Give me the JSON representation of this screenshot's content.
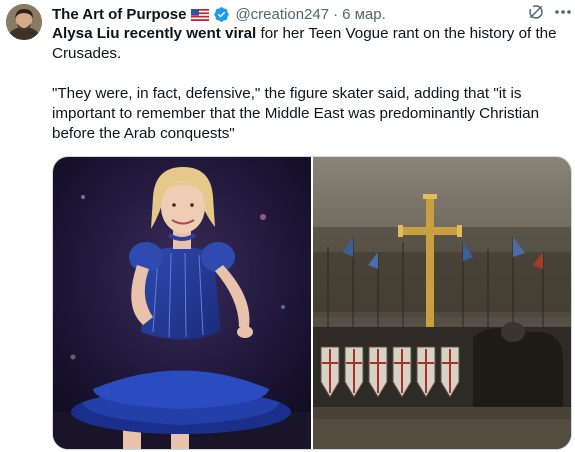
{
  "post": {
    "author_name": "The Art of Purpose",
    "flag_icon": "us-flag-icon",
    "verified_icon": "verified-badge-icon",
    "handle": "@creation247",
    "separator": "·",
    "timestamp": "6 мар.",
    "text_bold": "Alysa Liu recently went viral",
    "text_rest": " for her Teen Vogue rant on the history of the Crusades.",
    "quote": "\"They were, in fact, defensive,\" the figure skater said, adding that \"it is important to remember that the Middle East was predominantly Christian before the Arab conquests\""
  },
  "icons": {
    "grok": "grok-icon",
    "more": "more-options-icon"
  },
  "media": {
    "count": 2
  },
  "colors": {
    "text_primary": "#0f1419",
    "text_secondary": "#536471",
    "verified_blue": "#1d9bf0",
    "border": "#cfd9de"
  }
}
